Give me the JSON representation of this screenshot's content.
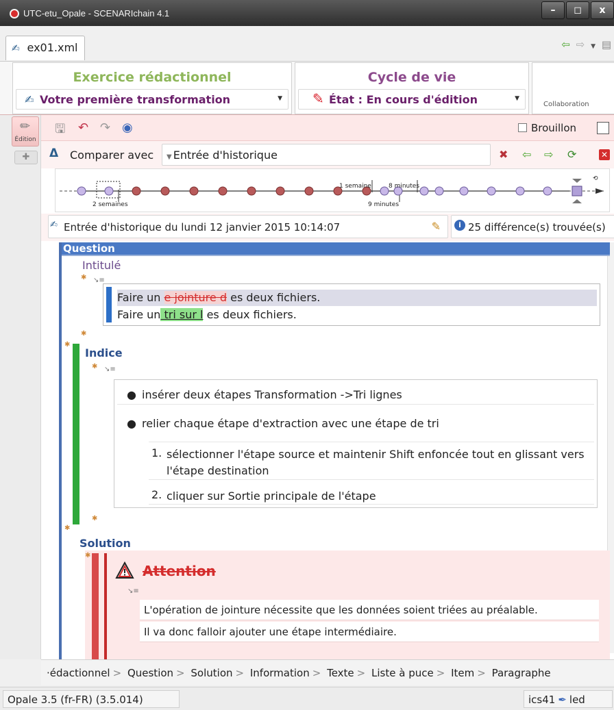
{
  "window": {
    "title": "UTC-etu_Opale - SCENARIchain 4.1",
    "min": "–",
    "max": "◻",
    "close": "x"
  },
  "tab": {
    "label": "ex01.xml"
  },
  "panels": {
    "exercise_title": "Exercice rédactionnel",
    "exercise_value": "Votre première transformation",
    "lifecycle_title": "Cycle de vie",
    "lifecycle_value": "État : En cours d'édition",
    "collab_label": "Collaboration"
  },
  "side": {
    "edit_label": "Édition"
  },
  "toolbar": {
    "draft_label": "Brouillon"
  },
  "compare": {
    "label": "Comparer avec",
    "history_value": "Entrée d'historique"
  },
  "timeline": {
    "label_2w": "2 semaines",
    "label_1w": "1 semaine",
    "label_8m": "8 minutes",
    "label_9m": "9 minutes"
  },
  "history": {
    "entry": "Entrée d'historique du lundi 12 janvier 2015 10:14:07",
    "diff_count": "25 différence(s) trouvée(s)"
  },
  "doc": {
    "question_header": "Question",
    "intitule_label": "Intitulé",
    "line1_pre": "Faire un",
    "line1_del": "e jointure d",
    "line1_post": "es deux fichiers.",
    "line2_pre": "Faire un",
    "line2_ins": " tri sur l",
    "line2_post": "es deux fichiers.",
    "indice_label": "Indice",
    "bullets": [
      "insérer deux étapes Transformation ->Tri lignes",
      "relier chaque étape d'extraction avec une étape de tri"
    ],
    "steps": [
      {
        "num": "1.",
        "text": "sélectionner l'étape source et maintenir Shift enfoncée tout en glissant vers l'étape destination"
      },
      {
        "num": "2.",
        "text": "cliquer sur Sortie principale de l'étape"
      }
    ],
    "solution_label": "Solution",
    "attention_label": "Attention",
    "sol_line1": "L'opération de jointure nécessite que les données soient triées au préalable.",
    "sol_line2": "Il va donc falloir ajouter une étape intermédiaire."
  },
  "breadcrumb": [
    "·édactionnel",
    "Question",
    "Solution",
    "Information",
    "Texte",
    "Liste à puce",
    "Item",
    "Paragraphe"
  ],
  "status": {
    "left": "Opale 3.5 (fr-FR) (3.5.014)",
    "right_a": "ics41",
    "right_b": "led"
  },
  "colors": {
    "accent_blue": "#4a79c5",
    "insert_green": "#8ee08a",
    "delete_red": "#d42d2d",
    "indice_green": "#2ea83a"
  }
}
